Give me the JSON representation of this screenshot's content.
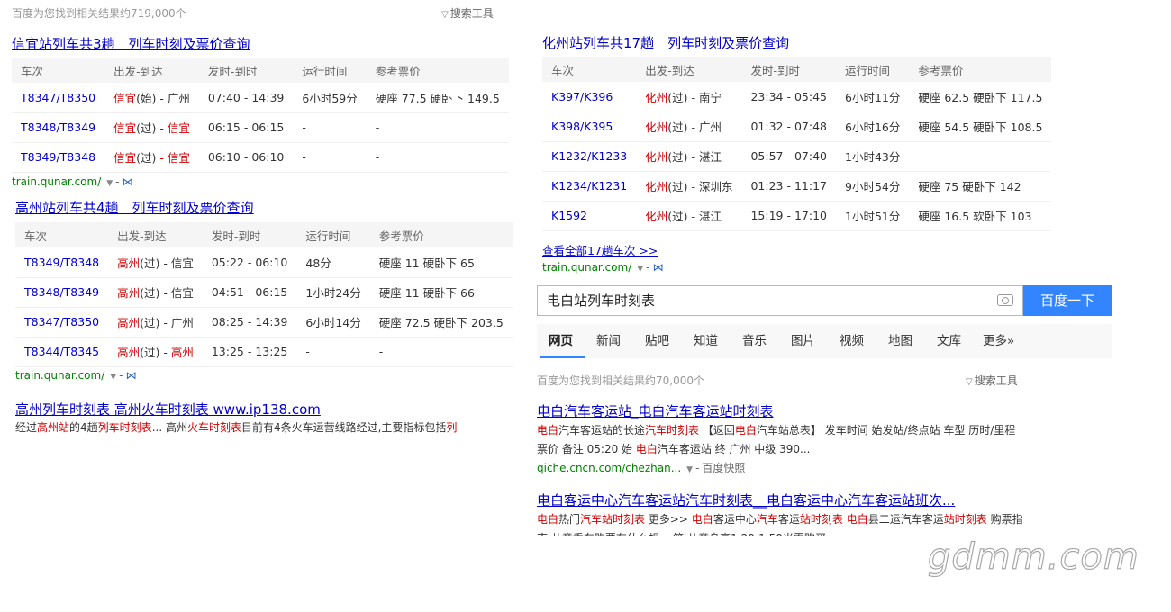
{
  "left": {
    "stat": "百度为您找到相关结果约719,000个",
    "tool_label": "搜索工具",
    "r1": {
      "title": "信宜站列车共3趟　列车时刻及票价查询",
      "headers": [
        "车次",
        "出发-到达",
        "发时-到时",
        "运行时间",
        "参考票价"
      ],
      "rows": [
        {
          "num": "T8347/T8350",
          "st": "信宜",
          "tag": "(始)",
          "dest": " - 广州",
          "time": "07:40 - 14:39",
          "dur": "6小时59分",
          "price": "硬座 77.5 硬卧下 149.5"
        },
        {
          "num": "T8348/T8349",
          "st": "信宜",
          "tag": "(过)",
          "dest": " - 信宜",
          "time": "06:15 - 06:15",
          "dur": "-",
          "price": "-"
        },
        {
          "num": "T8349/T8348",
          "st": "信宜",
          "tag": "(过)",
          "dest": " - 信宜",
          "time": "06:10 - 06:10",
          "dur": "-",
          "price": "-"
        }
      ],
      "url": "train.qunar.com/"
    },
    "r2": {
      "title": "高州站列车共4趟　列车时刻及票价查询",
      "headers": [
        "车次",
        "出发-到达",
        "发时-到时",
        "运行时间",
        "参考票价"
      ],
      "rows": [
        {
          "num": "T8349/T8348",
          "st": "高州",
          "tag": "(过)",
          "dest": " - 信宜",
          "time": "05:22 - 06:10",
          "dur": "48分",
          "price": "硬座 11 硬卧下 65"
        },
        {
          "num": "T8348/T8349",
          "st": "高州",
          "tag": "(过)",
          "dest": " - 信宜",
          "time": "04:51 - 06:15",
          "dur": "1小时24分",
          "price": "硬座 11 硬卧下 66"
        },
        {
          "num": "T8347/T8350",
          "st": "高州",
          "tag": "(过)",
          "dest": " - 广州",
          "time": "08:25 - 14:39",
          "dur": "6小时14分",
          "price": "硬座 72.5 硬卧下 203.5"
        },
        {
          "num": "T8344/T8345",
          "st": "高州",
          "tag": "(过)",
          "dest": " - 高州",
          "time": "13:25 - 13:25",
          "dur": "-",
          "price": "-"
        }
      ],
      "url": "train.qunar.com/"
    },
    "r3": {
      "title": "高州列车时刻表 高州火车时刻表 www.ip138.com",
      "snippet_a": "经过",
      "snippet_b": "高州站",
      "snippet_c": "的4趟",
      "snippet_d": "列车时刻表",
      "snippet_e": "... 高州",
      "snippet_f": "火车时刻表",
      "snippet_g": "目前有4条火车运营线路经过,主要指标包括",
      "snippet_h": "列"
    }
  },
  "right": {
    "r1": {
      "title": "化州站列车共17趟　列车时刻及票价查询",
      "headers": [
        "车次",
        "出发-到达",
        "发时-到时",
        "运行时间",
        "参考票价"
      ],
      "rows": [
        {
          "num": "K397/K396",
          "st": "化州",
          "tag": "(过)",
          "dest": " - 南宁",
          "time": "23:34 - 05:45",
          "dur": "6小时11分",
          "price": "硬座 62.5 硬卧下 117.5"
        },
        {
          "num": "K398/K395",
          "st": "化州",
          "tag": "(过)",
          "dest": " - 广州",
          "time": "01:32 - 07:48",
          "dur": "6小时16分",
          "price": "硬座 54.5 硬卧下 108.5"
        },
        {
          "num": "K1232/K1233",
          "st": "化州",
          "tag": "(过)",
          "dest": " - 湛江",
          "time": "05:57 - 07:40",
          "dur": "1小时43分",
          "price": "-"
        },
        {
          "num": "K1234/K1231",
          "st": "化州",
          "tag": "(过)",
          "dest": " - 深圳东",
          "time": "01:23 - 11:17",
          "dur": "9小时54分",
          "price": "硬座 75 硬卧下 142"
        },
        {
          "num": "K1592",
          "st": "化州",
          "tag": "(过)",
          "dest": " - 湛江",
          "time": "15:19 - 17:10",
          "dur": "1小时51分",
          "price": "硬座 16.5 软卧下 103"
        }
      ],
      "more": "查看全部17趟车次 >>",
      "url": "train.qunar.com/"
    },
    "search": {
      "query": "电白站列车时刻表",
      "button": "百度一下"
    },
    "tabs": [
      "网页",
      "新闻",
      "贴吧",
      "知道",
      "音乐",
      "图片",
      "视频",
      "地图",
      "文库",
      "更多»"
    ],
    "stat": "百度为您找到相关结果约70,000个",
    "tool_label": "搜索工具",
    "r2": {
      "title": "电白汽车客运站_电白汽车客运站时刻表",
      "url": "qiche.cncn.com/chezhan...",
      "snapshot": "百度快照"
    },
    "r3": {
      "title": "电白客运中心汽车客运站汽车时刻表__电白客运中心汽车客运站班次..."
    }
  },
  "watermark": "gdmm.com"
}
